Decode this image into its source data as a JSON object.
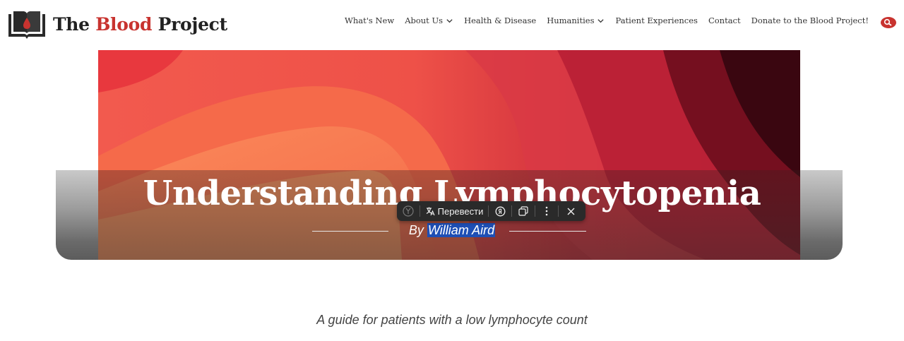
{
  "brand": {
    "name_prefix": "The ",
    "name_accent": "Blood",
    "name_suffix": " Project",
    "accent_color": "#c8332f"
  },
  "nav": {
    "items": [
      {
        "label": "What's New",
        "has_dropdown": false
      },
      {
        "label": "About Us",
        "has_dropdown": true
      },
      {
        "label": "Health & Disease",
        "has_dropdown": false
      },
      {
        "label": "Humanities",
        "has_dropdown": true
      },
      {
        "label": "Patient Experiences",
        "has_dropdown": false
      },
      {
        "label": "Contact",
        "has_dropdown": false
      },
      {
        "label": "Donate to the Blood Project!",
        "has_dropdown": false
      }
    ],
    "search_icon": "search-icon"
  },
  "hero": {
    "title": "Understanding Lymphocytopenia",
    "byline_prefix": "By ",
    "author": "William Aird"
  },
  "translate_popup": {
    "translate_label": "Перевести",
    "icons": [
      "yandex-logo-icon",
      "translate-icon",
      "yandex-search-icon",
      "copy-icon",
      "more-icon",
      "close-icon"
    ]
  },
  "article": {
    "subtitle": "A guide for patients with a low lymphocyte count"
  }
}
